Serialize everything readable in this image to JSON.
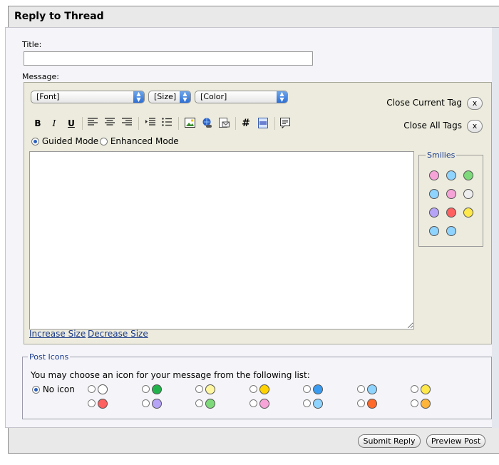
{
  "header": {
    "title": "Reply to Thread"
  },
  "form": {
    "title_label": "Title:",
    "title_value": "",
    "message_label": "Message:"
  },
  "editor": {
    "font_select": "[Font]",
    "size_select": "[Size]",
    "color_select": "[Color]",
    "close_current_tag": "Close Current Tag",
    "close_all_tags": "Close All Tags",
    "tag_button": "x",
    "toolbar": {
      "bold": "B",
      "italic": "I",
      "underline": "U",
      "hash": "#"
    },
    "modes": {
      "guided": "Guided Mode",
      "enhanced": "Enhanced Mode",
      "selected": "guided"
    },
    "resize": {
      "increase": "Increase Size",
      "decrease": "Decrease Size"
    },
    "smilies_title": "Smilies",
    "smilies": [
      {
        "icon": "tongue-smiley-icon",
        "color": "#f6a4d8"
      },
      {
        "icon": "smile-smiley-icon",
        "color": "#8fd3ff"
      },
      {
        "icon": "grin-smiley-icon",
        "color": "#7ed97a"
      },
      {
        "icon": "confused-smiley-icon",
        "color": "#8fd3ff"
      },
      {
        "icon": "laugh-smiley-icon",
        "color": "#f6a4d8"
      },
      {
        "icon": "eek-smiley-icon",
        "color": "#eeeeee"
      },
      {
        "icon": "frown-smiley-icon",
        "color": "#b6a4f6"
      },
      {
        "icon": "mad-smiley-icon",
        "color": "#ff6060"
      },
      {
        "icon": "happy-smiley-icon",
        "color": "#ffe84a"
      },
      {
        "icon": "rolleyes-smiley-icon",
        "color": "#8fd3ff"
      },
      {
        "icon": "cool-smiley-icon",
        "color": "#8fd3ff"
      }
    ]
  },
  "post_icons": {
    "legend": "Post Icons",
    "description": "You may choose an icon for your message from the following list:",
    "no_icon_label": "No icon",
    "icons": [
      {
        "icon": "post-document-icon",
        "color": "#ffffff"
      },
      {
        "icon": "post-arrow-icon",
        "color": "#22b24c"
      },
      {
        "icon": "post-lightbulb-icon",
        "color": "#fff6a0"
      },
      {
        "icon": "post-exclamation-icon",
        "color": "#ffd200"
      },
      {
        "icon": "post-question-icon",
        "color": "#3a9cf0"
      },
      {
        "icon": "post-cool-icon",
        "color": "#8fd3ff"
      },
      {
        "icon": "post-smile-icon",
        "color": "#ffe84a"
      },
      {
        "icon": "post-angry-icon",
        "color": "#ff6060"
      },
      {
        "icon": "post-frown-icon",
        "color": "#b6a4f6"
      },
      {
        "icon": "post-grin-icon",
        "color": "#7ed97a"
      },
      {
        "icon": "post-laugh-icon",
        "color": "#f6a4d8"
      },
      {
        "icon": "post-wink-icon",
        "color": "#8fd3ff"
      },
      {
        "icon": "post-thumbs-down-icon",
        "color": "#ff6a2a"
      },
      {
        "icon": "post-thumbs-up-icon",
        "color": "#ffb43a"
      }
    ]
  },
  "buttons": {
    "submit": "Submit Reply",
    "preview": "Preview Post"
  }
}
